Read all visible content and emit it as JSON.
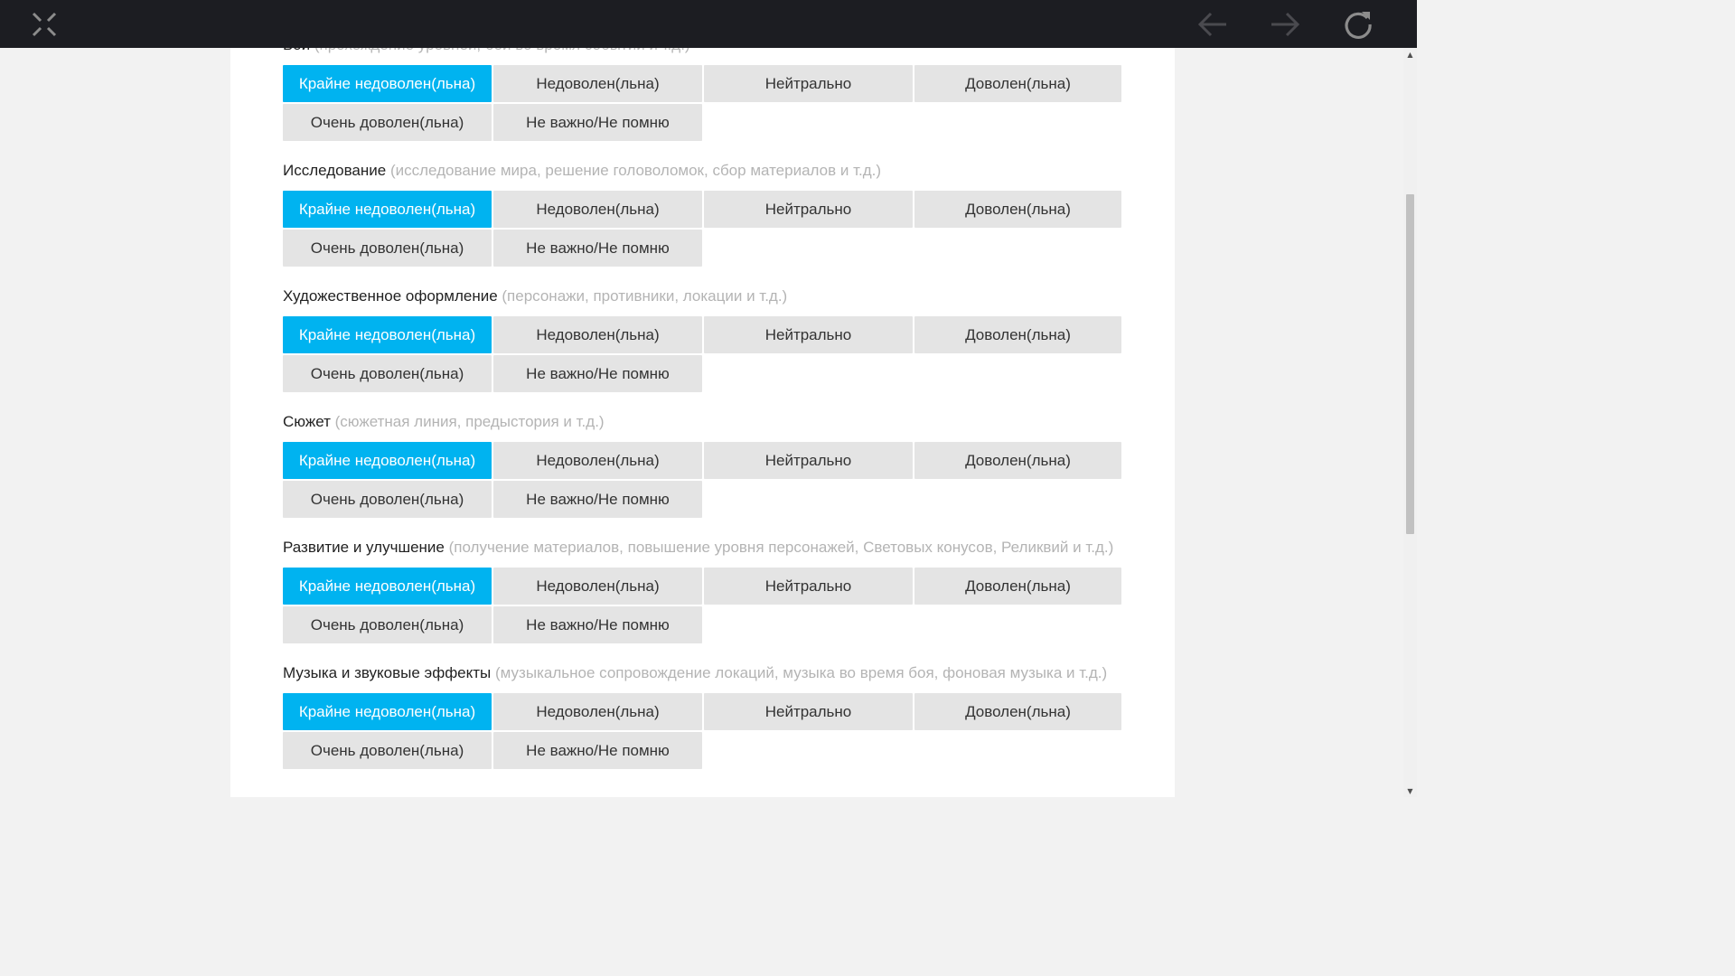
{
  "toolbar": {
    "close_icon": "close-x-icon",
    "back_icon": "arrow-left-icon",
    "forward_icon": "arrow-right-icon",
    "reload_icon": "reload-icon"
  },
  "options": [
    "Крайне недоволен(льна)",
    "Недоволен(льна)",
    "Нейтрально",
    "Доволен(льна)",
    "Очень доволен(льна)",
    "Не важно/Не помню"
  ],
  "questions": [
    {
      "title": "Бой",
      "hint": "(прохождение уровней, бои во время событий и т.д.)",
      "selected": 0
    },
    {
      "title": "Исследование",
      "hint": "(исследование мира, решение головоломок, сбор материалов и т.д.)",
      "selected": 0
    },
    {
      "title": "Художественное оформление",
      "hint": "(персонажи, противники, локации и т.д.)",
      "selected": 0
    },
    {
      "title": "Сюжет",
      "hint": "(сюжетная линия, предыстория и т.д.)",
      "selected": 0
    },
    {
      "title": "Развитие и улучшение",
      "hint": "(получение материалов, повышение уровня персонажей, Световых конусов, Реликвий и т.д.)",
      "selected": 0
    },
    {
      "title": "Музыка и звуковые эффекты",
      "hint": "(музыкальное сопровождение локаций, музыка во время боя, фоновая музыка и т.д.)",
      "selected": 0
    }
  ],
  "colors": {
    "selected": "#00b3f0",
    "option_bg": "#e4e4e4",
    "hint": "#b4b4b4",
    "topbar": "#1c1d22"
  }
}
